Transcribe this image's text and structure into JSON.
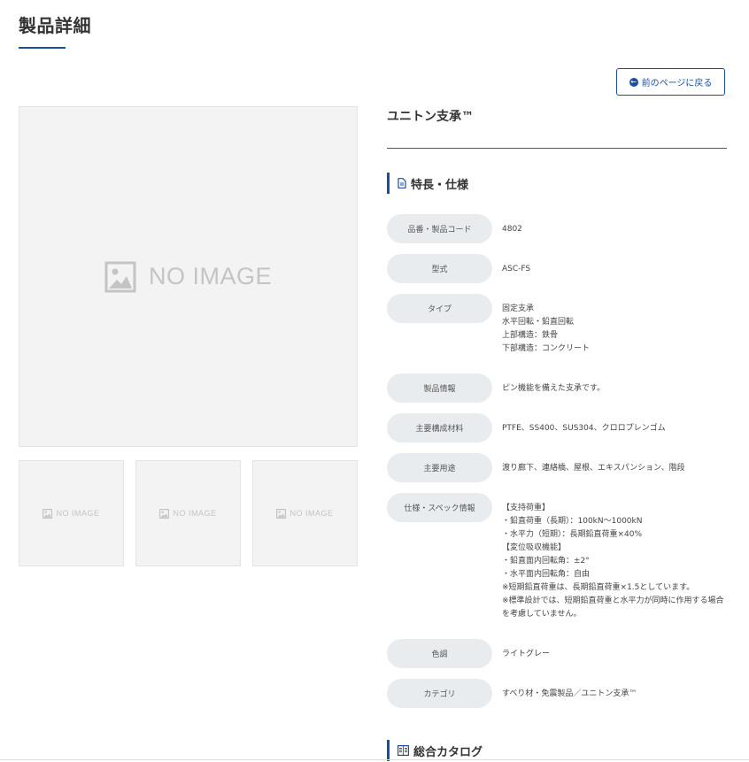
{
  "page": {
    "title": "製品詳細"
  },
  "back_button": {
    "label": "前のページに戻る",
    "icon": "arrow-left-circle-icon"
  },
  "gallery": {
    "main_placeholder": "NO IMAGE",
    "thumbnails": [
      "NO IMAGE",
      "NO IMAGE",
      "NO IMAGE"
    ]
  },
  "product": {
    "name": "ユニトン支承™"
  },
  "specs_section": {
    "heading": "特長・仕様",
    "icon": "document-icon",
    "rows": [
      {
        "label": "品番・製品コード",
        "value": "4802"
      },
      {
        "label": "型式",
        "value": "ASC-FS"
      },
      {
        "label": "タイプ",
        "value": "固定支承\n水平回転・鉛直回転\n上部構造：鉄骨\n下部構造：コンクリート"
      },
      {
        "label": "製品情報",
        "value": "ピン機能を備えた支承です。"
      },
      {
        "label": "主要構成材料",
        "value": "PTFE、SS400、SUS304、クロロプレンゴム"
      },
      {
        "label": "主要用途",
        "value": "渡り廊下、連絡橋、屋根、エキスパンション、階段"
      },
      {
        "label": "仕様・スペック情報",
        "value": "【支持荷重】\n・鉛直荷重（長期）：100kN～1000kN\n・水平力（短期）：長期鉛直荷重×40%\n【変位吸収機能】\n・鉛直面内回転角：±2°\n・水平面内回転角：自由\n※短期鉛直荷重は、長期鉛直荷重×1.5としています。\n※標準設計では、短期鉛直荷重と水平力が同時に作用する場合を考慮していません。"
      },
      {
        "label": "色調",
        "value": "ライトグレー"
      },
      {
        "label": "カテゴリ",
        "value": "すべり材・免震製品／ユニトン支承™"
      }
    ]
  },
  "catalog_section": {
    "heading": "総合カタログ",
    "icon": "book-icon"
  },
  "colors": {
    "accent": "#1a4fa0",
    "label_bg": "#e9ecef",
    "placeholder_bg": "#f3f3f3"
  }
}
